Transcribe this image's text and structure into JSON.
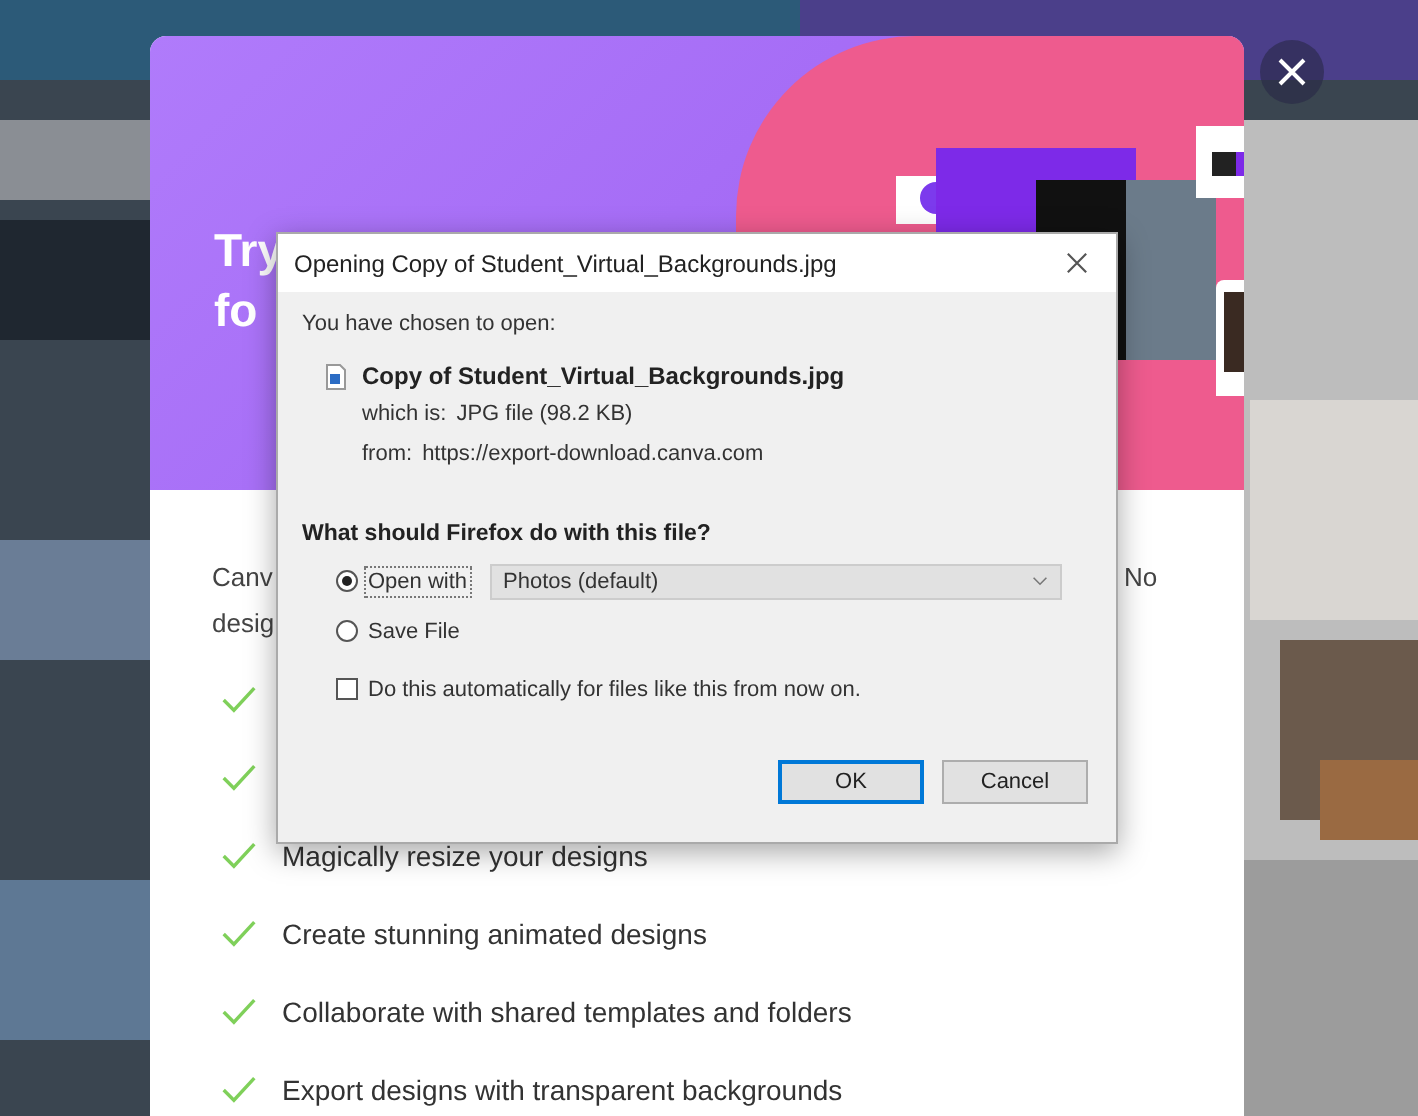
{
  "modal": {
    "heading": [
      "Try",
      "fo"
    ],
    "intro_left": [
      "Canv",
      "desig"
    ],
    "intro_right": "No",
    "features": [
      {
        "kind": "check"
      },
      {
        "kind": "check"
      },
      {
        "kind": "item",
        "label": "Magically resize your designs"
      },
      {
        "kind": "item",
        "label": "Create stunning animated designs"
      },
      {
        "kind": "item",
        "label": "Collaborate with shared templates and folders"
      },
      {
        "kind": "item",
        "label": "Export designs with transparent backgrounds"
      }
    ]
  },
  "dialog": {
    "title": "Opening Copy of Student_Virtual_Backgrounds.jpg",
    "intro": "You have chosen to open:",
    "file_name": "Copy of Student_Virtual_Backgrounds.jpg",
    "details": [
      {
        "label": "which is:",
        "value": "JPG file (98.2 KB)"
      },
      {
        "label": "from:",
        "value": "https://export-download.canva.com"
      }
    ],
    "question": "What should Firefox do with this file?",
    "options": [
      {
        "kind": "open",
        "label": "Open with",
        "selected": true
      },
      {
        "kind": "save",
        "label": "Save File",
        "selected": false
      }
    ],
    "app_select": {
      "value": "Photos (default)"
    },
    "auto_checkbox": {
      "label": "Do this automatically for files like this from now on.",
      "checked": false
    },
    "buttons": [
      {
        "label": "OK",
        "default": true
      },
      {
        "label": "Cancel",
        "default": false
      }
    ]
  }
}
